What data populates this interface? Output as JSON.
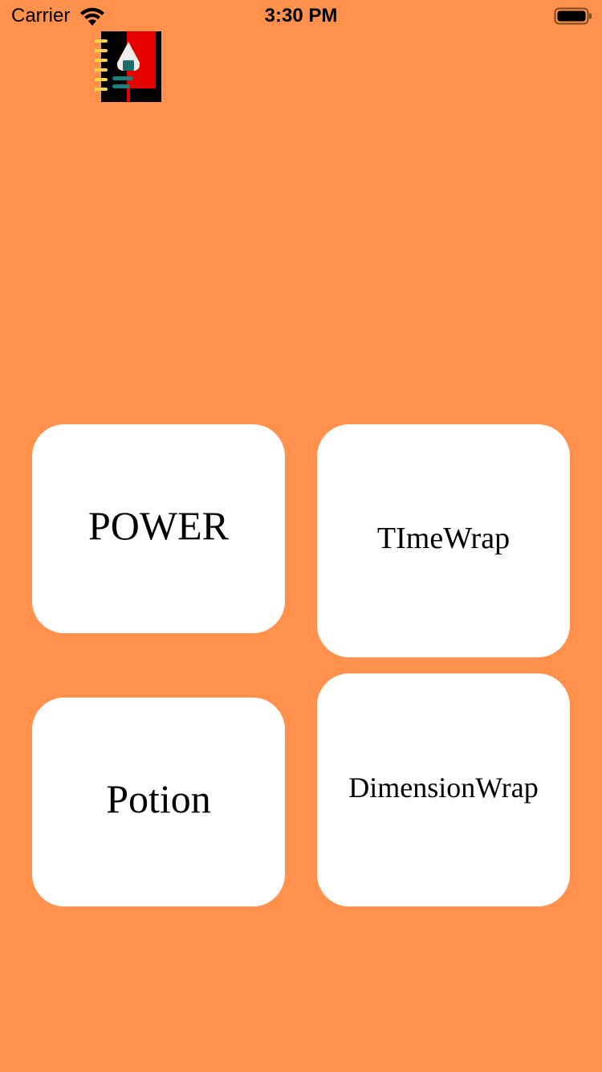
{
  "status_bar": {
    "carrier": "Carrier",
    "time": "3:30 PM",
    "wifi_icon": "wifi-icon",
    "battery_icon": "battery-icon"
  },
  "app": {
    "logo_icon": "notebook-onigiri-logo"
  },
  "menu": {
    "items": [
      {
        "label": "POWER"
      },
      {
        "label": "TImeWrap"
      },
      {
        "label": "Potion"
      },
      {
        "label": "DimensionWrap"
      }
    ]
  },
  "colors": {
    "background": "#FF914D",
    "card": "#FFFFFF",
    "text": "#000000"
  }
}
